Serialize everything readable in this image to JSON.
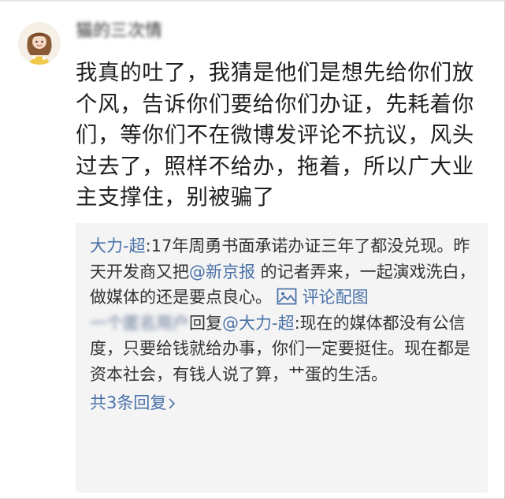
{
  "post": {
    "username": "猫的三次情",
    "text": "我真的吐了，我猜是他们是想先给你们放个风，告诉你们要给你们办证，先耗着你们，等你们不在微博发评论不抗议，风头过去了，照样不给办，拖着，所以广大业主支撑住，别被骗了"
  },
  "replies": {
    "reply1": {
      "user": "大力-超",
      "sep": ":",
      "text_a": "17年周勇书面承诺办证三年了都没兑现。昨天开发商又把",
      "mention": "@新京报",
      "text_b": " 的记者弄来，一起演戏洗白，做媒体的还是要点良心。",
      "image_link": "评论配图"
    },
    "reply2": {
      "user": "一个匿名用户",
      "reply_word": "回复",
      "mention": "@大力-超",
      "sep": ":",
      "text": "现在的媒体都没有公信度，只要给钱就给办事，你们一定要挺住。现在都是资本社会，有钱人说了算，艹蛋的生活。"
    },
    "more": "共3条回复"
  },
  "colors": {
    "link": "#4a71a8",
    "reply_bg": "#f4f4f5",
    "text": "#1f1f1f"
  },
  "icons": [
    "avatar",
    "image-icon",
    "chevron-right-icon"
  ]
}
